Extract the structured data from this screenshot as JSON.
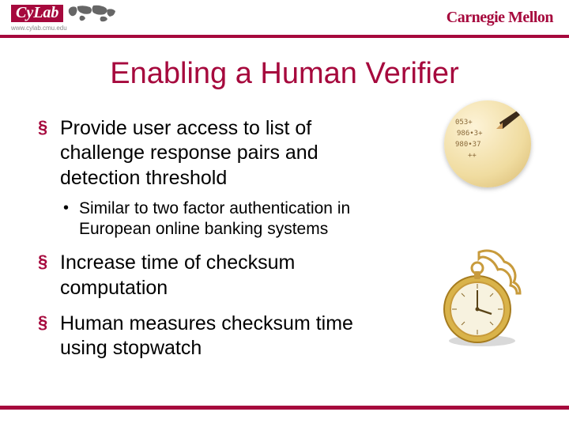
{
  "header": {
    "cylab_brand": "CyLab",
    "cylab_url": "www.cylab.cmu.edu",
    "university": "Carnegie Mellon"
  },
  "title": "Enabling a Human Verifier",
  "bullets": [
    {
      "text": "Provide user access to list of challenge response pairs and detection threshold",
      "sub": [
        "Similar to two factor authentication in European online banking systems"
      ]
    },
    {
      "text": "Increase time of checksum computation",
      "sub": []
    },
    {
      "text": "Human measures checksum time using stopwatch",
      "sub": []
    }
  ],
  "images": {
    "top_alt": "numbers-sheet-with-pencil",
    "bottom_alt": "gold-pocket-watch"
  },
  "colors": {
    "accent": "#a6093d"
  }
}
